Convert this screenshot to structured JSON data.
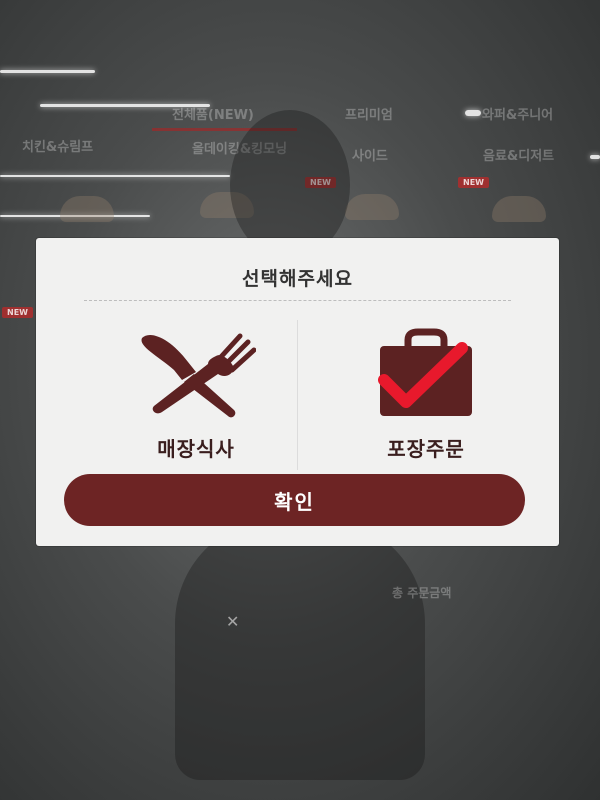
{
  "background": {
    "tabs": [
      "전체품(NEW)",
      "프리미엄",
      "와퍼&주니어",
      "치킨&슈림프",
      "올데이킹&킹모닝",
      "사이드",
      "음료&디저트"
    ],
    "badges": [
      "NEW",
      "NEW",
      "NEW"
    ],
    "summary_label": "총 주문금액"
  },
  "modal": {
    "title": "선택해주세요",
    "options": [
      {
        "label": "매장식사",
        "icon": "fork-knife-icon",
        "selected": false
      },
      {
        "label": "포장주문",
        "icon": "shopping-bag-icon",
        "selected": true
      }
    ],
    "confirm_label": "확인"
  },
  "colors": {
    "primary": "#6d2424",
    "icon": "#5c2222",
    "check": "#e8192c",
    "modal_bg": "#f1f1f0"
  }
}
